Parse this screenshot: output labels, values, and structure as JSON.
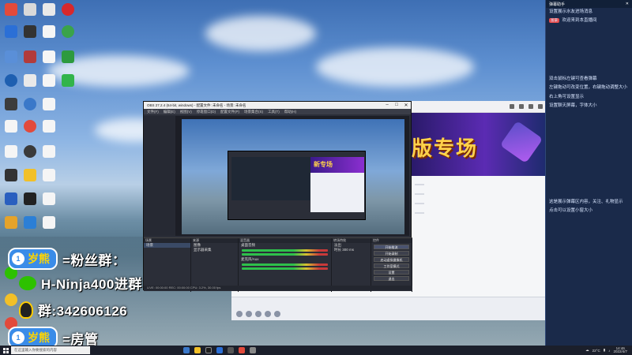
{
  "overlay": {
    "badge1_num": "1",
    "badge1_text": "岁熊",
    "line1": "=粉丝群：",
    "line2": "H-Ninja400进群",
    "line3": "群:342606126",
    "badge2_num": "1",
    "badge2_text": "岁熊",
    "line4": "=房管"
  },
  "right_panel": {
    "title": "弹幕助手",
    "messages": [
      "设置展示水友进场消息",
      "欢迎来到本直播间",
      "双击鼠标左键可查看弹幕",
      "左键拖动可改变位置，右键拖动调整大小",
      "右上角可设置显示",
      "设置聊天屏幕，字体大小"
    ],
    "chip": "富豪",
    "note_a": "这是展示弹幕区内容，关注、礼物显示",
    "note_b": "点击可以设置小窗大小"
  },
  "obs": {
    "title": "OBS 27.2.4 (64-bit, windows) - 配置文件: 未命名 - 场景: 未命名",
    "menu": [
      "文件(F)",
      "编辑(E)",
      "视图(V)",
      "停靠窗口(D)",
      "配置文件(P)",
      "场景集合(S)",
      "工具(T)",
      "帮助(H)"
    ],
    "docks": {
      "scenes_title": "场景",
      "scenes": [
        "场景"
      ],
      "sources_title": "来源",
      "sources": [
        "图像",
        "显示器采集"
      ],
      "mixer_title": "混音器",
      "mixer": [
        "桌面音频",
        "麦克风/Aux"
      ],
      "transitions_title": "转场特效",
      "transition": "淡出",
      "duration_label": "时长",
      "duration": "300 ms",
      "controls_title": "控件",
      "controls": [
        "开始推流",
        "开始录制",
        "启动虚拟摄像机",
        "工作室模式",
        "设置",
        "退出"
      ]
    },
    "status": "LIVE: 00:00:00   REC: 00:00:00   CPU: 3.2%, 30.00 fps",
    "nested_banner": "新专场"
  },
  "browser": {
    "banner_text": "版专场"
  },
  "taskbar": {
    "search_placeholder": "在这里输入你要搜索的内容",
    "weather": "22°C",
    "time": "14:46",
    "date": "2022/4/7"
  }
}
